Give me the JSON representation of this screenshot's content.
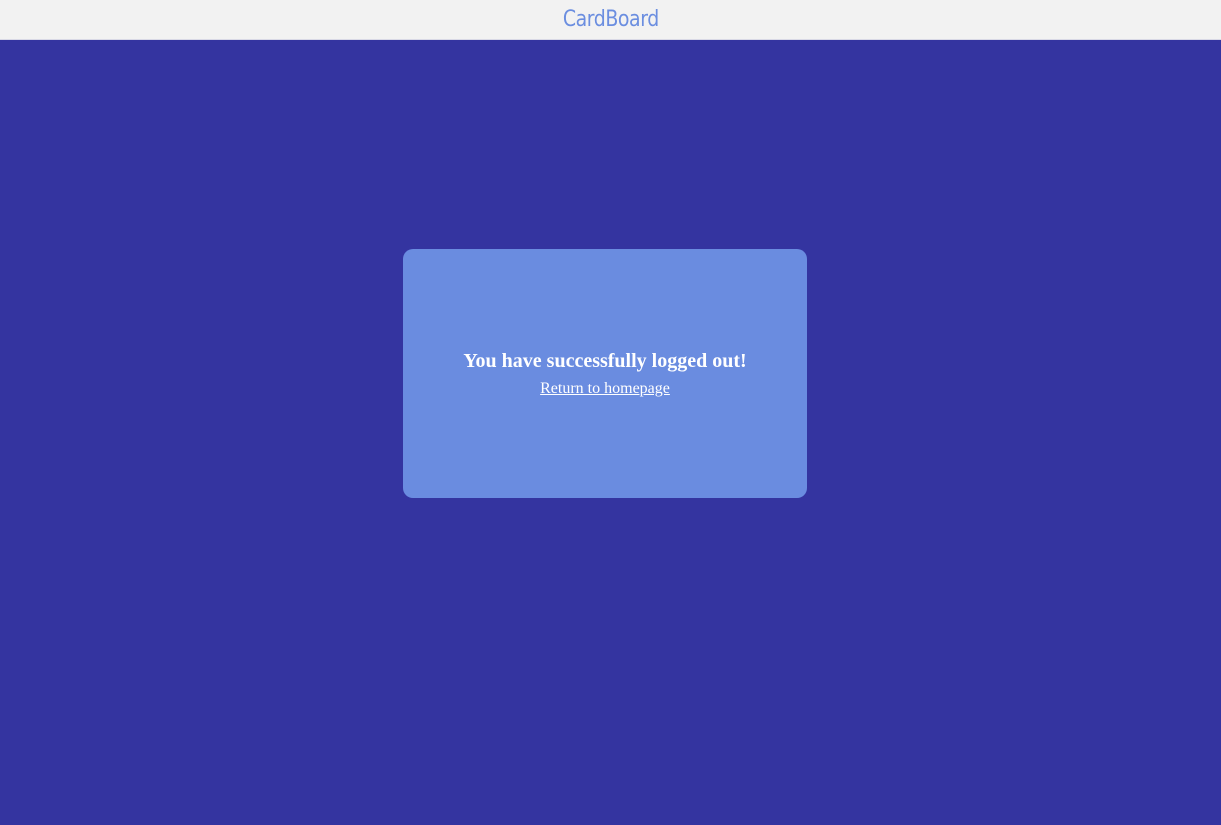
{
  "header": {
    "brand": "CardBoard"
  },
  "logout_card": {
    "message": "You have successfully logged out!",
    "link_label": "Return to homepage"
  },
  "colors": {
    "header_bg": "#f2f2f2",
    "brand_text": "#6b8ee0",
    "page_bg": "#3434a0",
    "card_bg": "#6a8ce0",
    "card_text": "#ffffff"
  }
}
